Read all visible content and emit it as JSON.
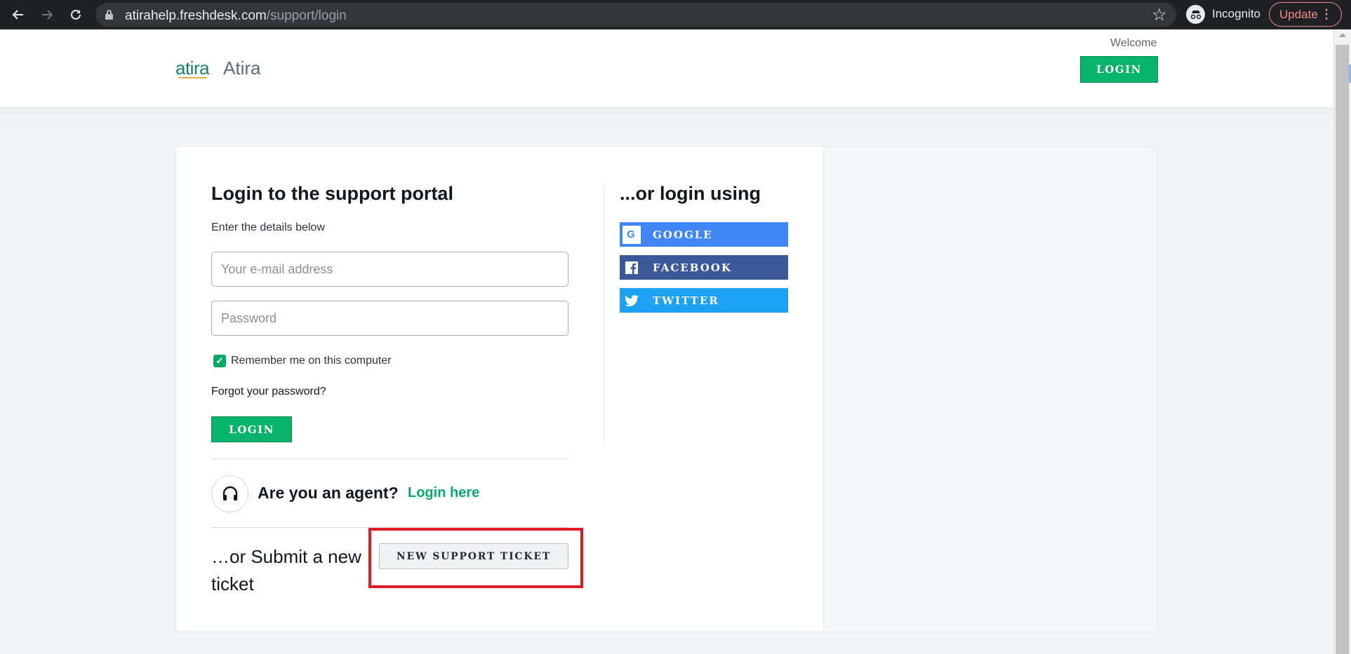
{
  "browser": {
    "url_host": "atirahelp.freshdesk.com",
    "url_path": "/support/login",
    "incognito_label": "Incognito",
    "update_label": "Update",
    "icons": [
      "back-arrow-icon",
      "forward-arrow-icon",
      "reload-icon",
      "lock-icon",
      "star-icon",
      "incognito-icon",
      "more-vert-icon"
    ]
  },
  "header": {
    "logo_text": "atira",
    "brand_name": "Atira",
    "welcome": "Welcome",
    "login_label": "LOGIN"
  },
  "login_form": {
    "title": "Login to the support portal",
    "subtitle": "Enter the details below",
    "email_placeholder": "Your e-mail address",
    "email_value": "",
    "password_placeholder": "Password",
    "password_value": "",
    "remember_label": "Remember me on this computer",
    "remember_checked": true,
    "forgot_label": "Forgot your password?",
    "login_label": "LOGIN"
  },
  "agent": {
    "question": "Are you an agent?",
    "link_label": "Login here"
  },
  "ticket": {
    "text": "…or Submit a new ticket",
    "button_label": "NEW SUPPORT TICKET"
  },
  "social": {
    "title": "...or login using",
    "google_label": "GOOGLE",
    "facebook_label": "FACEBOOK",
    "twitter_label": "TWITTER"
  },
  "colors": {
    "brand_green": "#08b36a",
    "google_blue": "#4285f4",
    "facebook_blue": "#3b5998",
    "twitter_blue": "#1da1f2",
    "highlight_red": "#e01b24"
  }
}
